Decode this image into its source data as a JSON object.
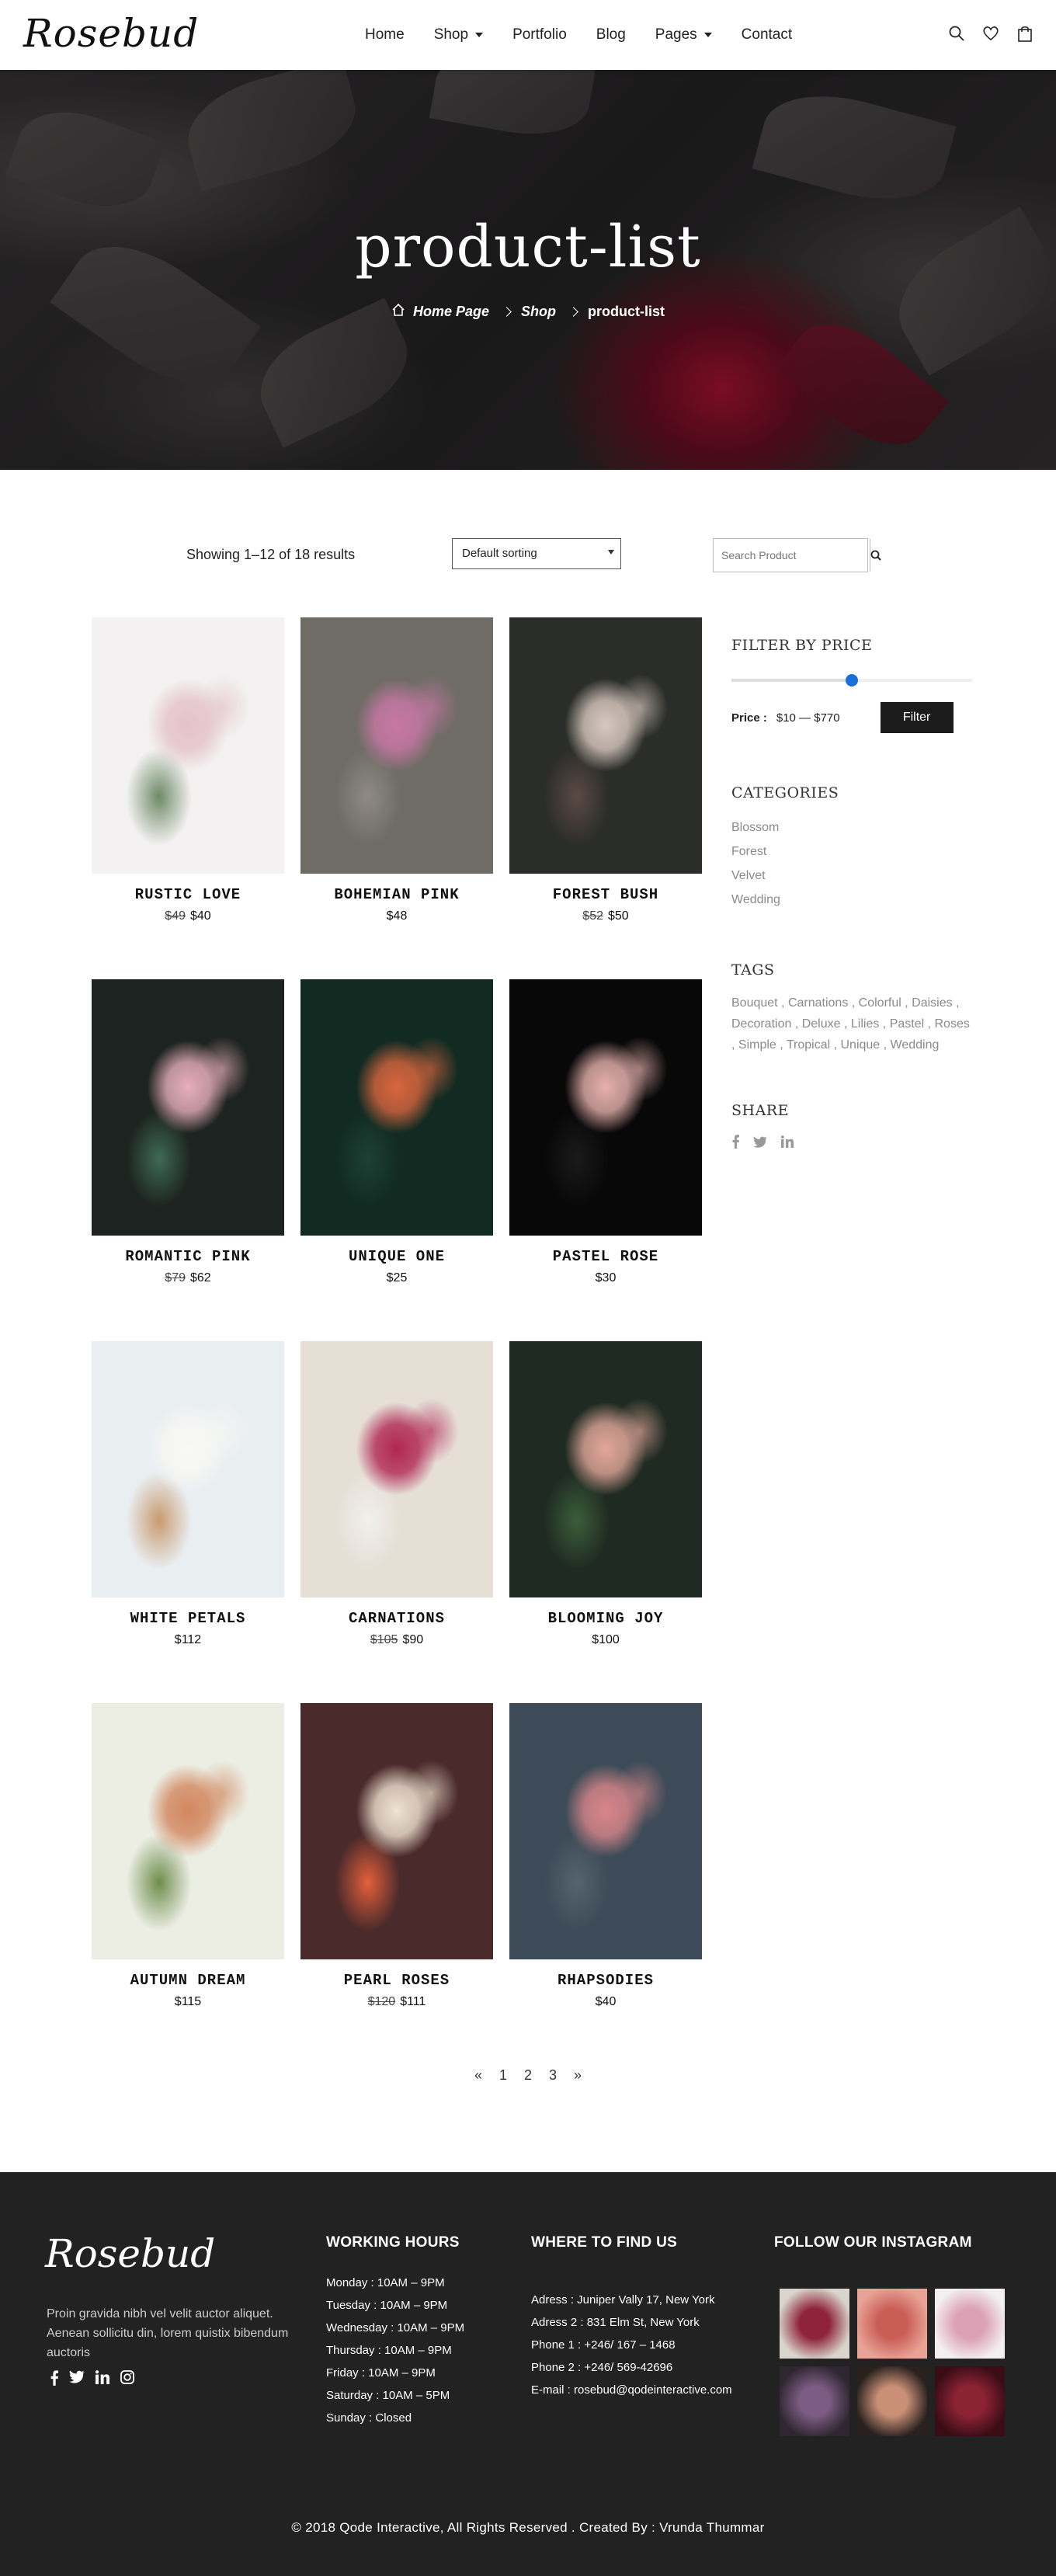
{
  "header": {
    "logo": "Rosebud",
    "nav": [
      {
        "label": "Home",
        "dropdown": false
      },
      {
        "label": "Shop",
        "dropdown": true
      },
      {
        "label": "Portfolio",
        "dropdown": false
      },
      {
        "label": "Blog",
        "dropdown": false
      },
      {
        "label": "Pages",
        "dropdown": true
      },
      {
        "label": "Contact",
        "dropdown": false
      }
    ],
    "icons": [
      "search-icon",
      "heart-icon",
      "bag-icon"
    ]
  },
  "hero": {
    "title": "product-list",
    "breadcrumb": {
      "home": "Home Page",
      "shop": "Shop",
      "current": "product-list"
    }
  },
  "toolbar": {
    "results": "Showing 1–12 of 18 results",
    "sort_selected": "Default sorting",
    "search_placeholder": "Search Product"
  },
  "products": [
    {
      "name": "RUSTIC LOVE",
      "old_price": "$49",
      "price": "$40",
      "colors": [
        "#f3f1f1",
        "#e4c2c9",
        "#6d8a66"
      ]
    },
    {
      "name": "BOHEMIAN PINK",
      "old_price": "",
      "price": "$48",
      "colors": [
        "#6f6c66",
        "#c877a5",
        "#8f8b83"
      ]
    },
    {
      "name": "FOREST BUSH",
      "old_price": "$52",
      "price": "$50",
      "colors": [
        "#2b2d2a",
        "#d8c9bf",
        "#5b4a45"
      ]
    },
    {
      "name": "ROMANTIC PINK",
      "old_price": "$79",
      "price": "$62",
      "colors": [
        "#1d2320",
        "#e7aebf",
        "#3f6a55"
      ]
    },
    {
      "name": "UNIQUE ONE",
      "old_price": "",
      "price": "$25",
      "colors": [
        "#112a22",
        "#d8663e",
        "#1d4134"
      ]
    },
    {
      "name": "PASTEL ROSE",
      "old_price": "",
      "price": "$30",
      "colors": [
        "#080808",
        "#e6b1ad",
        "#1a1a1a"
      ]
    },
    {
      "name": "WHITE PETALS",
      "old_price": "",
      "price": "$112",
      "colors": [
        "#e9eef1",
        "#f8f8f4",
        "#c99a6f"
      ]
    },
    {
      "name": "CARNATIONS",
      "old_price": "$105",
      "price": "$90",
      "colors": [
        "#e6dfd6",
        "#b02654",
        "#f1f0ec"
      ]
    },
    {
      "name": "BLOOMING JOY",
      "old_price": "",
      "price": "$100",
      "colors": [
        "#1f2b22",
        "#e2a79a",
        "#3b5e3a"
      ]
    },
    {
      "name": "AUTUMN DREAM",
      "old_price": "",
      "price": "$115",
      "colors": [
        "#eceee4",
        "#d2875f",
        "#6d8d4c"
      ]
    },
    {
      "name": "PEARL ROSES",
      "old_price": "$120",
      "price": "$111",
      "colors": [
        "#4a2a2b",
        "#f0e3d2",
        "#e4603a"
      ]
    },
    {
      "name": "RHAPSODIES",
      "old_price": "",
      "price": "$40",
      "colors": [
        "#3c4b57",
        "#d9868a",
        "#55636e"
      ]
    }
  ],
  "sidebar": {
    "filter_title": "FILTER BY PRICE",
    "price_label": "Price :",
    "price_range": "$10 — $770",
    "slider_fraction": 0.5,
    "filter_button": "Filter",
    "categories_title": "CATEGORIES",
    "categories": [
      "Blossom",
      "Forest",
      "Velvet",
      "Wedding"
    ],
    "tags_title": "TAGS",
    "tags": [
      "Bouquet",
      "Carnations",
      "Colorful",
      "Daisies",
      "Decoration",
      "Deluxe",
      "Lilies",
      "Pastel",
      "Roses",
      "Simple",
      "Tropical",
      "Unique",
      "Wedding"
    ],
    "share_title": "SHARE",
    "share_icons": [
      "facebook-icon",
      "twitter-icon",
      "linkedin-icon"
    ]
  },
  "pagination": [
    "«",
    "1",
    "2",
    "3",
    "»"
  ],
  "footer": {
    "logo": "Rosebud",
    "text": "Proin gravida nibh vel velit auctor aliquet. Aenean sollicitu din, lorem quistix bibendum auctoris",
    "social": [
      "facebook-icon",
      "twitter-icon",
      "linkedin-icon",
      "instagram-icon"
    ],
    "hours_title": "WORKING HOURS",
    "hours": [
      "Monday : 10AM – 9PM",
      "Tuesday : 10AM – 9PM",
      "Wednesday : 10AM – 9PM",
      "Thursday : 10AM – 9PM",
      "Friday : 10AM – 9PM",
      "Saturday : 10AM – 5PM",
      "Sunday : Closed"
    ],
    "find_title": "WHERE TO FIND US",
    "find": [
      "Adress : Juniper Vally 17, New York",
      "Adress 2 : 831 Elm St, New York",
      "Phone 1 : +246/ 167 – 1468",
      "Phone 2 : +246/ 569-42696",
      "E-mail : rosebud@qodeinteractive.com"
    ],
    "insta_title": "FOLLOW OUR INSTAGRAM",
    "insta_colors": [
      [
        "#d9d5cc",
        "#8e2339"
      ],
      [
        "#e9a396",
        "#c95e57"
      ],
      [
        "#f2eff0",
        "#dca1b4"
      ],
      [
        "#2f2631",
        "#7c5c83"
      ],
      [
        "#2a211f",
        "#c99076"
      ],
      [
        "#3a0d16",
        "#8c2334"
      ]
    ],
    "copyright": "© 2018 Qode Interactive, All Rights Reserved . Created By : Vrunda Thummar"
  }
}
